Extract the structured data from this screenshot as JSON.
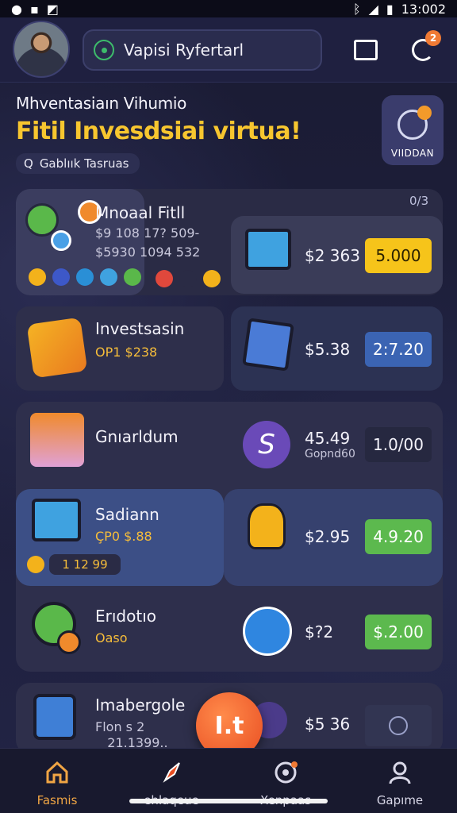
{
  "status_bar": {
    "time": "13:002",
    "left_icons": [
      "circle-icon",
      "message-icon",
      "photo-icon"
    ],
    "right_icons": [
      "bluetooth-icon",
      "signal-icon",
      "battery-icon"
    ]
  },
  "header": {
    "search_label": "Vapisi Ryfertarl",
    "notification_count": "2"
  },
  "hero": {
    "subtitle": "Mhventasiaın Vihumio",
    "title": "Fitil Invesdsiai virtua!",
    "chip_prefix": "Q",
    "chip_label": "Gablıık  Tasruas",
    "action_label": "VIIDDAN"
  },
  "rows": [
    {
      "title": "Mnoaal Fitll",
      "sub1": "$9 108  17? 509-",
      "sub2": "$5930  1094 532",
      "price": "$2 363",
      "pill": "5.000",
      "corner": "0/3"
    },
    {
      "title": "Investsasin",
      "sub": "OP1 $238",
      "price": "$5.38",
      "pill": "2:7.20"
    },
    {
      "title": "Gnıarldum",
      "price": "45.49",
      "price_sub": "Gopnd60",
      "pill": "1.0/00"
    },
    {
      "title": "Sadiann",
      "sub": "ÇP0 $.88",
      "mini": "1  12  99",
      "price": "$2.95",
      "pill": "4.9.20"
    },
    {
      "title": "Erıdotıo",
      "sub": "Oaso",
      "price": "$?2",
      "pill": "$.2.00"
    },
    {
      "title": "Imabergole",
      "sub": "Flon s  2",
      "sub2": "   21.1399..",
      "price": "$5 36"
    }
  ],
  "fab_label": "I.t",
  "nav": [
    {
      "label": "Fasmis",
      "icon": "home-icon",
      "active": true
    },
    {
      "label": "ehlaqeue",
      "icon": "rocket-icon"
    },
    {
      "label": "Xenpaas",
      "icon": "target-icon"
    },
    {
      "label": "Gapıme",
      "icon": "profile-icon"
    }
  ],
  "colors": {
    "accent": "#f7c62f",
    "brand_orange": "#f07a34",
    "background": "#1c1d35"
  }
}
